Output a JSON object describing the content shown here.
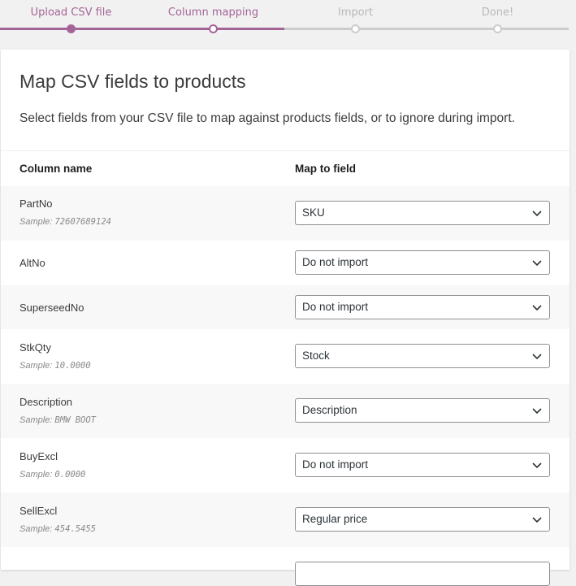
{
  "steps": [
    {
      "label": "Upload CSV file",
      "state": "done"
    },
    {
      "label": "Column mapping",
      "state": "active"
    },
    {
      "label": "Import",
      "state": "pending"
    },
    {
      "label": "Done!",
      "state": "pending"
    }
  ],
  "card": {
    "title": "Map CSV fields to products",
    "description": "Select fields from your CSV file to map against products fields, or to ignore during import."
  },
  "table": {
    "col_name_header": "Column name",
    "map_field_header": "Map to field",
    "sample_prefix": "Sample:",
    "rows": [
      {
        "name": "PartNo",
        "sample": "72607689124",
        "field": "SKU"
      },
      {
        "name": "AltNo",
        "sample": "",
        "field": "Do not import"
      },
      {
        "name": "SuperseedNo",
        "sample": "",
        "field": "Do not import"
      },
      {
        "name": "StkQty",
        "sample": "10.0000",
        "field": "Stock"
      },
      {
        "name": "Description",
        "sample": "BMW BOOT",
        "field": "Description"
      },
      {
        "name": "BuyExcl",
        "sample": "0.0000",
        "field": "Do not import"
      },
      {
        "name": "SellExcl",
        "sample": "454.5455",
        "field": "Regular price"
      },
      {
        "name": "",
        "sample": "",
        "field": ""
      }
    ]
  },
  "colors": {
    "accent": "#a46497",
    "inactive": "#cccccc"
  }
}
